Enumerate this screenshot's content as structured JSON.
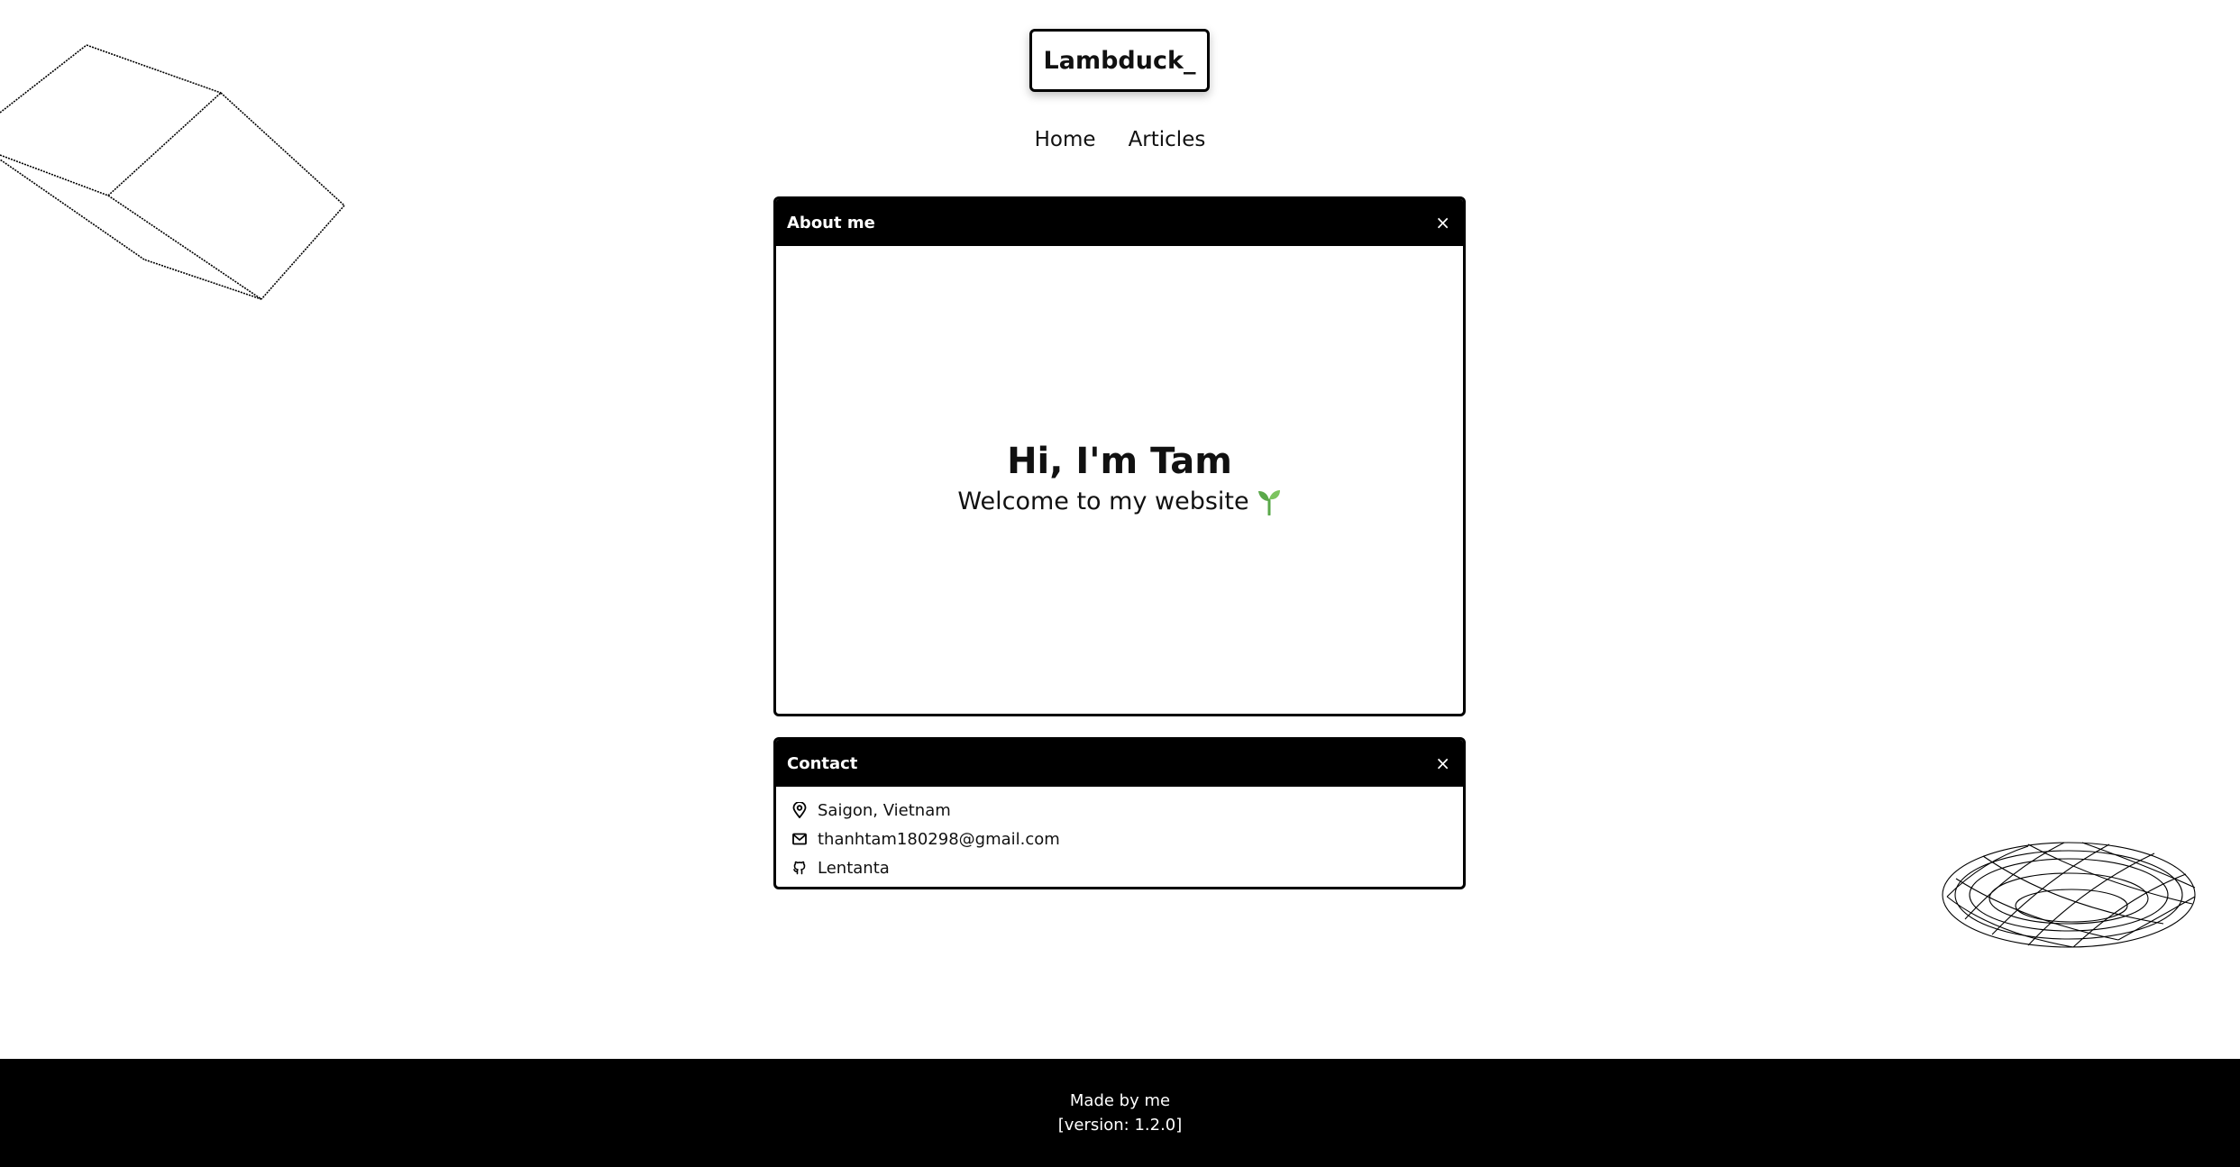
{
  "header": {
    "logo": "Lambduck_"
  },
  "nav": {
    "items": [
      {
        "label": "Home"
      },
      {
        "label": "Articles"
      }
    ]
  },
  "about_window": {
    "title": "About me",
    "close": "×",
    "greeting": "Hi, I'm Tam",
    "welcome": "Welcome to my website",
    "welcome_icon": "seedling-icon"
  },
  "contact_window": {
    "title": "Contact",
    "close": "×",
    "items": [
      {
        "icon": "location-pin-icon",
        "text": "Saigon, Vietnam"
      },
      {
        "icon": "mail-icon",
        "text": "thanhtam180298@gmail.com"
      },
      {
        "icon": "github-icon",
        "text": "Lentanta"
      }
    ]
  },
  "footer": {
    "made_by": "Made by me",
    "version": "[version: 1.2.0]"
  },
  "colors": {
    "background": "#ffffff",
    "ink": "#000000",
    "seedling": "#5aa84a"
  }
}
